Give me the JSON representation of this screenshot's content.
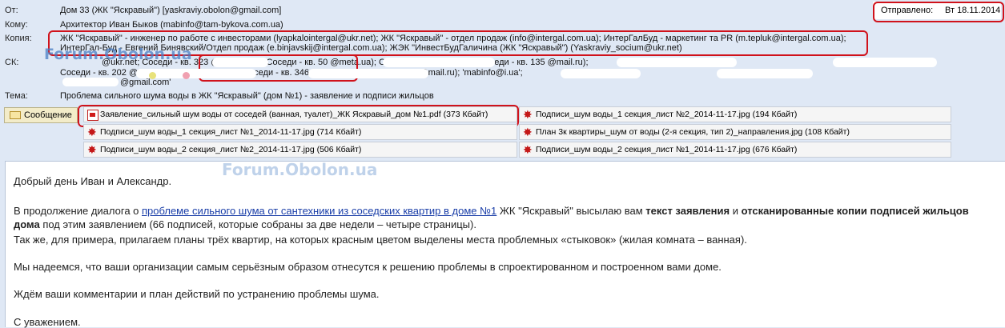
{
  "header": {
    "from_label": "От:",
    "from_value": "Дом 33 (ЖК \"Яскравый\") [yaskraviy.obolon@gmail.com]",
    "to_label": "Кому:",
    "to_value": "Архитектор Иван Быков (mabinfo@tam-bykova.com.ua)",
    "cc_label": "Копия:",
    "cc_line1": "ЖК \"Яскравый\" - инженер по работе с инвесторами (lyapkalointergal@ukr.net); ЖК \"Яскравый\" - отдел продаж (info@intergal.com.ua); ИнтерГалБуд - маркетинг та PR (m.tepluk@intergal.com.ua);",
    "cc_line2": "ИнтерГал-Буд - Евгений Бинявский/Отдел продаж (e.binjavskij@intergal.com.ua); ЖЭК \"ИнвестБудГаличина (ЖК \"Яскравый\") (Yaskraviy_socium@ukr.net)",
    "bcc_label": "СК:",
    "bcc_line1": "@ukr.net; Соседи - кв. 323 @yandex.ru); Соседи - кв. 50 @meta.ua); Соседи - кв. 238 @i.ua); Соседи - кв. 135 @mail.ru);",
    "bcc_line2": "Соседи - кв. 202 @gmail.com); @gmail.com); Соседи - кв. 346 @ua.fm); Соседи - кв. 364 @mail.ru); 'mabinfo@i.ua';",
    "bcc_line3": "@gmail.com'",
    "subject_label": "Тема:",
    "subject_value": "Проблема сильного шума воды в ЖК \"Яскравый\" (дом №1) - заявление и подписи жильцов",
    "sent_label": "Отправлено:",
    "sent_value": "Вт 18.11.2014"
  },
  "watermark": "Forum.Obolon.ua",
  "message_tab": "Сообщение",
  "attachments": [
    {
      "name": "Заявление_сильный шум воды от соседей (ванная, туалет)_ЖК Яскравый_дом №1.pdf (373 Кбайт)",
      "type": "pdf"
    },
    {
      "name": "Подписи_шум воды_1 секция_лист №2_2014-11-17.jpg (194 Кбайт)",
      "type": "jpg"
    },
    {
      "name": "Подписи_шум воды_1 секция_лист №1_2014-11-17.jpg (714 Кбайт)",
      "type": "jpg"
    },
    {
      "name": "План 3к квартиры_шум от воды (2-я секция, тип 2)_направления.jpg (108 Кбайт)",
      "type": "jpg"
    },
    {
      "name": "Подписи_шум воды_2 секция_лист №2_2014-11-17.jpg (506 Кбайт)",
      "type": "jpg"
    },
    {
      "name": "Подписи_шум воды_2 секция_лист №1_2014-11-17.jpg (676 Кбайт)",
      "type": "jpg"
    }
  ],
  "body": {
    "greeting": "Добрый день Иван и Александр.",
    "p1_a": "В продолжение диалога о ",
    "p1_link": "проблеме сильного шума от сантехники из соседских квартир в доме №1",
    "p1_b": " ЖК \"Яскравый\" высылаю вам ",
    "p1_bold1": "текст заявления",
    "p1_c": " и ",
    "p1_bold2": "отсканированные копии подписей жильцов",
    "p2_bold": "дома",
    "p2_rest": " под этим заявлением (66 подписей, которые  собраны за две недели – четыре страницы).",
    "p3": "Так же, для примера, прилагаем планы трёх квартир, на которых красным цветом выделены места проблемных «стыковок» (жилая комната – ванная).",
    "p4": "Мы надеемся, что ваши организации самым серьёзным образом  отнесутся к решению проблемы в спроектированном и построенном вами доме.",
    "p5": "Ждём ваши комментарии и план действий  по устранению проблемы шума.",
    "closing": "С уважением."
  },
  "colors": {
    "highlight": "#d0121b",
    "link": "#1a3ea8",
    "header_bg": "#dfe8f5"
  }
}
